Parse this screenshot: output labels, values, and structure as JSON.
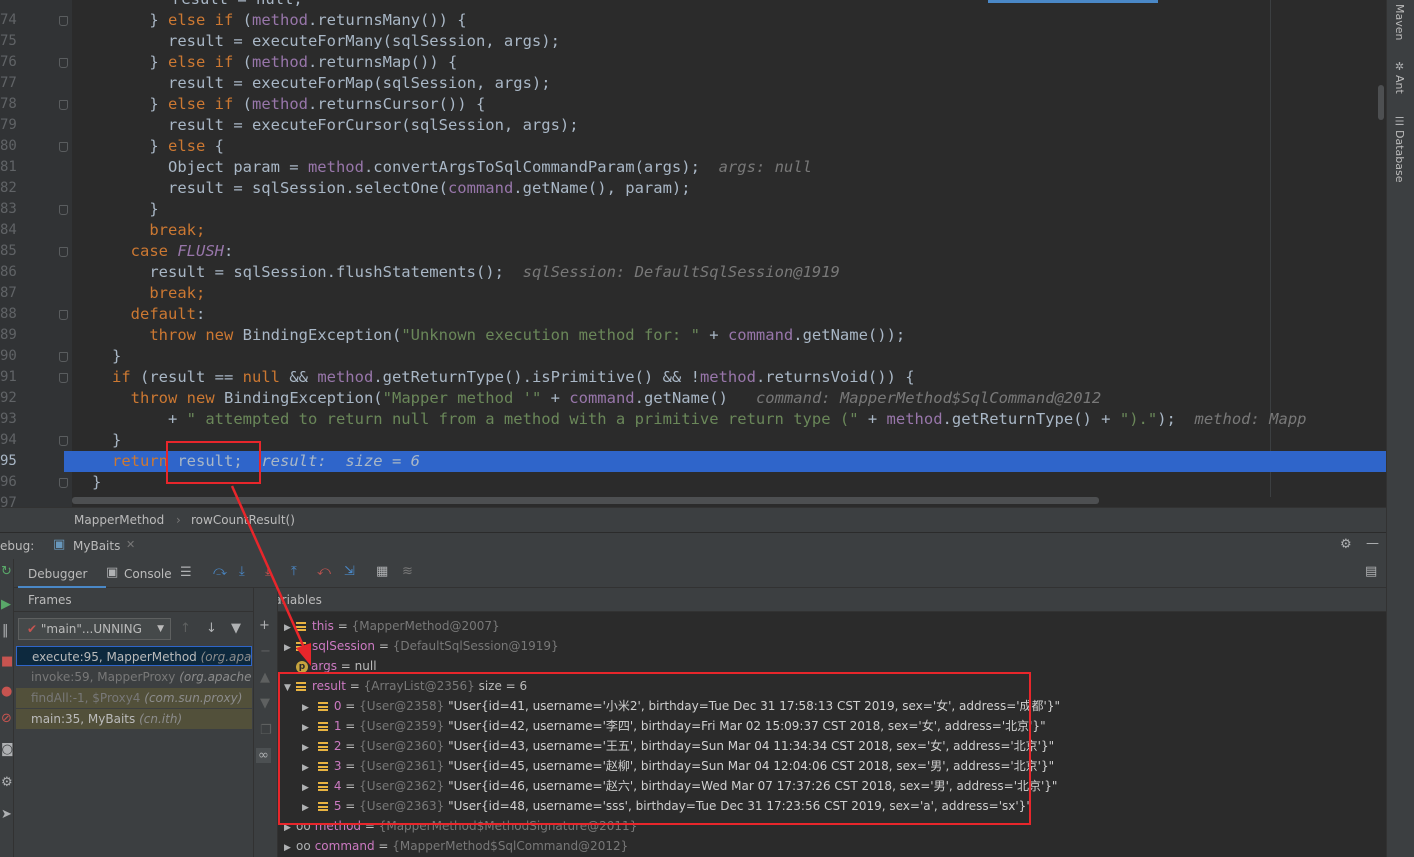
{
  "editor": {
    "lines": [
      {
        "n": "74",
        "html": "    } <k>else if</k> (<f>method</f>.returnsMany()) {"
      },
      {
        "n": "75",
        "html": "      result = executeForMany(sqlSession, args);"
      },
      {
        "n": "76",
        "html": "    } <k>else if</k> (<f>method</f>.returnsMap()) {"
      },
      {
        "n": "77",
        "html": "      result = executeForMap(sqlSession, args);"
      },
      {
        "n": "78",
        "html": "    } <k>else if</k> (<f>method</f>.returnsCursor()) {"
      },
      {
        "n": "79",
        "html": "      result = executeForCursor(sqlSession, args);"
      },
      {
        "n": "80",
        "html": "    } <k>else</k> {"
      },
      {
        "n": "81",
        "html": "      Object param = <f>method</f>.convertArgsToSqlCommandParam(args);  <h>args: null</h>"
      },
      {
        "n": "82",
        "html": "      result = sqlSession.selectOne(<f>command</f>.getName(), param);"
      },
      {
        "n": "83",
        "html": "    }"
      },
      {
        "n": "84",
        "html": "    <k>break;</k>"
      },
      {
        "n": "85",
        "html": "  <k>case</k> <fi>FLUSH</fi>:"
      },
      {
        "n": "86",
        "html": "    result = sqlSession.flushStatements();  <h>sqlSession: DefaultSqlSession@1919</h>"
      },
      {
        "n": "87",
        "html": "    <k>break;</k>"
      },
      {
        "n": "88",
        "html": "  <k>default</k>:"
      },
      {
        "n": "89",
        "html": "    <k>throw new</k> BindingException(<s>\"Unknown execution method for: \"</s> + <f>command</f>.getName());"
      },
      {
        "n": "90",
        "html": "}"
      },
      {
        "n": "91",
        "html": "<k>if</k> (result == <k>null</k> && <f>method</f>.getReturnType().isPrimitive() && !<f>method</f>.returnsVoid()) {"
      },
      {
        "n": "92",
        "html": "  <k>throw new</k> BindingException(<s>\"Mapper method '\"</s> + <f>command</f>.getName()   <h>command: MapperMethod$SqlCommand@2012</h>"
      },
      {
        "n": "93",
        "html": "      + <s>\" attempted to return null from a method with a primitive return type (\"</s> + <f>method</f>.getReturnType() + <s>\").\"</s>);  <h>method: Mapp</h>"
      },
      {
        "n": "94",
        "html": "}"
      },
      {
        "n": "95",
        "html": "<k>return</k> result;  <h>result:  size = 6</h>"
      },
      {
        "n": "96",
        "html": "}"
      },
      {
        "n": "97",
        "html": ""
      }
    ],
    "top_partial": "result = null;"
  },
  "right_strip": {
    "tabs": [
      "Maven",
      "Ant",
      "Database"
    ]
  },
  "breadcrumb": {
    "class_name": "MapperMethod",
    "separator": "›",
    "method_name": "rowCountResult()"
  },
  "debug": {
    "title": "ebug:",
    "config_name": "MyBaits",
    "tabs": {
      "debugger": "Debugger",
      "console": "Console"
    },
    "frames_title": "Frames",
    "variables_title": "Variables",
    "thread_select": "\"main\"...UNNING",
    "frames": [
      {
        "method": "execute:95, MapperMethod",
        "pkg": "(org.apac"
      },
      {
        "method": "invoke:59, MapperProxy",
        "pkg": "(org.apache.i"
      },
      {
        "method": "findAll:-1, $Proxy4",
        "pkg": "(com.sun.proxy)"
      },
      {
        "method": "main:35, MyBaits",
        "pkg": "(cn.ith)"
      }
    ],
    "variables": [
      {
        "name": "this",
        "ref": "{MapperMethod@2007}",
        "extra": ""
      },
      {
        "name": "sqlSession",
        "ref": "{DefaultSqlSession@1919}",
        "extra": ""
      },
      {
        "name": "args",
        "eq": "= null"
      },
      {
        "name": "result",
        "ref": "{ArrayList@2356}",
        "extra": "size = 6"
      },
      {
        "name": "method",
        "ref": "{MapperMethod$MethodSignature@2011}"
      },
      {
        "name": "command",
        "ref": "{MapperMethod$SqlCommand@2012}"
      }
    ],
    "result_items": [
      {
        "idx": "0",
        "ref": "{User@2358}",
        "value": "\"User{id=41, username='小米2', birthday=Tue Dec 31 17:58:13 CST 2019, sex='女', address='成都'}\""
      },
      {
        "idx": "1",
        "ref": "{User@2359}",
        "value": "\"User{id=42, username='李四', birthday=Fri Mar 02 15:09:37 CST 2018, sex='女', address='北京'}\""
      },
      {
        "idx": "2",
        "ref": "{User@2360}",
        "value": "\"User{id=43, username='王五', birthday=Sun Mar 04 11:34:34 CST 2018, sex='女', address='北京'}\""
      },
      {
        "idx": "3",
        "ref": "{User@2361}",
        "value": "\"User{id=45, username='赵柳', birthday=Sun Mar 04 12:04:06 CST 2018, sex='男', address='北京'}\""
      },
      {
        "idx": "4",
        "ref": "{User@2362}",
        "value": "\"User{id=46, username='赵六', birthday=Wed Mar 07 17:37:26 CST 2018, sex='男', address='北京'}\""
      },
      {
        "idx": "5",
        "ref": "{User@2363}",
        "value": "\"User{id=48, username='sss', birthday=Tue Dec 31 17:23:56 CST 2019, sex='a', address='sx'}\""
      }
    ]
  },
  "colors": {
    "annotation": "#e8262b",
    "selection": "#2f65ca",
    "keyword": "#cc7832",
    "field": "#9876aa",
    "string": "#6a8759"
  },
  "icons": [
    "gear-icon",
    "minimize-icon",
    "step-over-icon",
    "step-into-icon",
    "force-step-into-icon",
    "step-out-icon",
    "drop-frame-icon",
    "run-to-cursor-icon",
    "evaluate-icon",
    "trace-icon",
    "filter-icon",
    "restore-layout-icon"
  ]
}
